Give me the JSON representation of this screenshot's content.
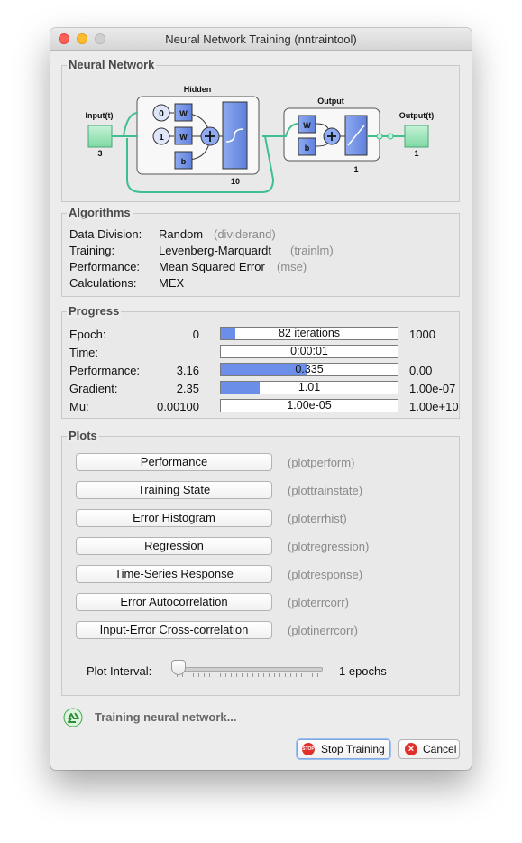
{
  "window": {
    "title": "Neural Network Training (nntraintool)"
  },
  "network": {
    "section": "Neural Network",
    "input_label": "Input(t)",
    "input_size": "3",
    "hidden_label": "Hidden",
    "hidden_size": "10",
    "output_layer_label": "Output",
    "output_layer_size": "1",
    "output_label": "Output(t)",
    "output_size": "1",
    "delay0": "0",
    "delay1": "1",
    "w": "W",
    "b": "b"
  },
  "algorithms": {
    "section": "Algorithms",
    "rows": [
      {
        "label": "Data Division:",
        "value": "Random",
        "fn": "(dividerand)"
      },
      {
        "label": "Training:",
        "value": "Levenberg-Marquardt",
        "fn": "(trainlm)"
      },
      {
        "label": "Performance:",
        "value": "Mean Squared Error",
        "fn": "(mse)"
      },
      {
        "label": "Calculations:",
        "value": "MEX",
        "fn": ""
      }
    ]
  },
  "progress": {
    "section": "Progress",
    "rows": [
      {
        "label": "Epoch:",
        "start": "0",
        "current": "82 iterations",
        "end": "1000",
        "fill": 0.082
      },
      {
        "label": "Time:",
        "start": "",
        "current": "0:00:01",
        "end": "",
        "fill": 0
      },
      {
        "label": "Performance:",
        "start": "3.16",
        "current": "0.335",
        "end": "0.00",
        "fill": 0.49
      },
      {
        "label": "Gradient:",
        "start": "2.35",
        "current": "1.01",
        "end": "1.00e-07",
        "fill": 0.22
      },
      {
        "label": "Mu:",
        "start": "0.00100",
        "current": "1.00e-05",
        "end": "1.00e+10",
        "fill": 0
      }
    ]
  },
  "plots": {
    "section": "Plots",
    "buttons": [
      {
        "label": "Performance",
        "fn": "(plotperform)"
      },
      {
        "label": "Training State",
        "fn": "(plottrainstate)"
      },
      {
        "label": "Error Histogram",
        "fn": "(ploterrhist)"
      },
      {
        "label": "Regression",
        "fn": "(plotregression)"
      },
      {
        "label": "Time-Series Response",
        "fn": "(plotresponse)"
      },
      {
        "label": "Error Autocorrelation",
        "fn": "(ploterrcorr)"
      },
      {
        "label": "Input-Error Cross-correlation",
        "fn": "(plotinerrcorr)"
      }
    ],
    "interval_label": "Plot Interval:",
    "interval_value": "1 epochs",
    "interval_slider": 0
  },
  "status": {
    "text": "Training neural network...",
    "icon": "recycle-icon"
  },
  "actions": {
    "stop_label": "Stop Training",
    "stop_icon_text": "STOP",
    "cancel_label": "Cancel"
  },
  "colors": {
    "bar_fill": "#6b8fe8",
    "layer_box": "#6f8fe0",
    "io_box": "#8fe0b0",
    "connector": "#3fbf8f"
  }
}
